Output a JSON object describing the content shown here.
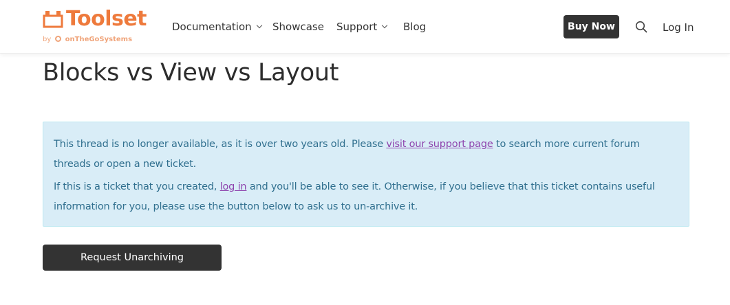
{
  "brand": {
    "name": "Toolset",
    "by": "by",
    "company": "onTheGoSystems",
    "color": "#ee7a3c"
  },
  "nav": {
    "items": [
      {
        "label": "Documentation",
        "has_dropdown": true
      },
      {
        "label": "Showcase",
        "has_dropdown": false
      },
      {
        "label": "Support",
        "has_dropdown": true
      },
      {
        "label": "Blog",
        "has_dropdown": false
      }
    ]
  },
  "header_actions": {
    "buy_label": "Buy Now",
    "search_icon": "search-icon",
    "login_label": "Log In"
  },
  "page": {
    "title": "Blocks vs View vs Layout"
  },
  "notice": {
    "p1_before": "This thread is no longer available, as it is over two years old. Please ",
    "p1_link": "visit our support page",
    "p1_after": " to search more current forum threads or open a new ticket.",
    "p2_before": "If this is a ticket that you created, ",
    "p2_link": "log in",
    "p2_after": " and you'll be able to see it. Otherwise, if you believe that this ticket contains useful information for you, please use the button below to ask us to un-archive it.",
    "background": "#d9edf7",
    "text_color": "#31708f",
    "link_color": "#8e44ad"
  },
  "actions": {
    "request_label": "Request Unarchiving"
  }
}
